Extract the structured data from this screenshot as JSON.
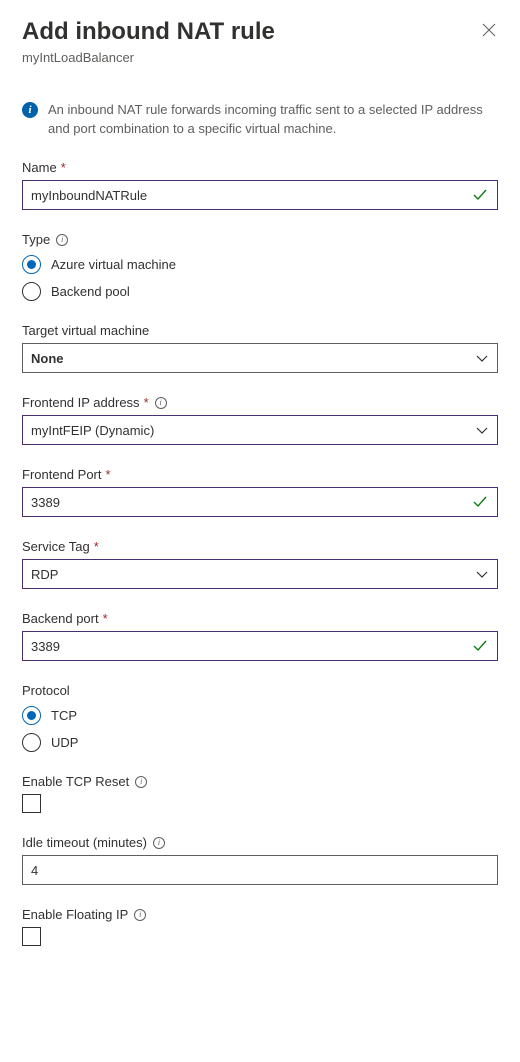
{
  "header": {
    "title": "Add inbound NAT rule",
    "subtitle": "myIntLoadBalancer"
  },
  "info": {
    "text": "An inbound NAT rule forwards incoming traffic sent to a selected IP address and port combination to a specific virtual machine."
  },
  "fields": {
    "name": {
      "label": "Name",
      "value": "myInboundNATRule"
    },
    "type": {
      "label": "Type",
      "options": {
        "azure_vm": "Azure virtual machine",
        "backend_pool": "Backend pool"
      },
      "selected": "azure_vm"
    },
    "target_vm": {
      "label": "Target virtual machine",
      "value": "None"
    },
    "frontend_ip": {
      "label": "Frontend IP address",
      "value": "myIntFEIP (Dynamic)"
    },
    "frontend_port": {
      "label": "Frontend Port",
      "value": "3389"
    },
    "service_tag": {
      "label": "Service Tag",
      "value": "RDP"
    },
    "backend_port": {
      "label": "Backend port",
      "value": "3389"
    },
    "protocol": {
      "label": "Protocol",
      "options": {
        "tcp": "TCP",
        "udp": "UDP"
      },
      "selected": "tcp"
    },
    "tcp_reset": {
      "label": "Enable TCP Reset",
      "checked": false
    },
    "idle_timeout": {
      "label": "Idle timeout (minutes)",
      "value": "4"
    },
    "floating_ip": {
      "label": "Enable Floating IP",
      "checked": false
    }
  }
}
